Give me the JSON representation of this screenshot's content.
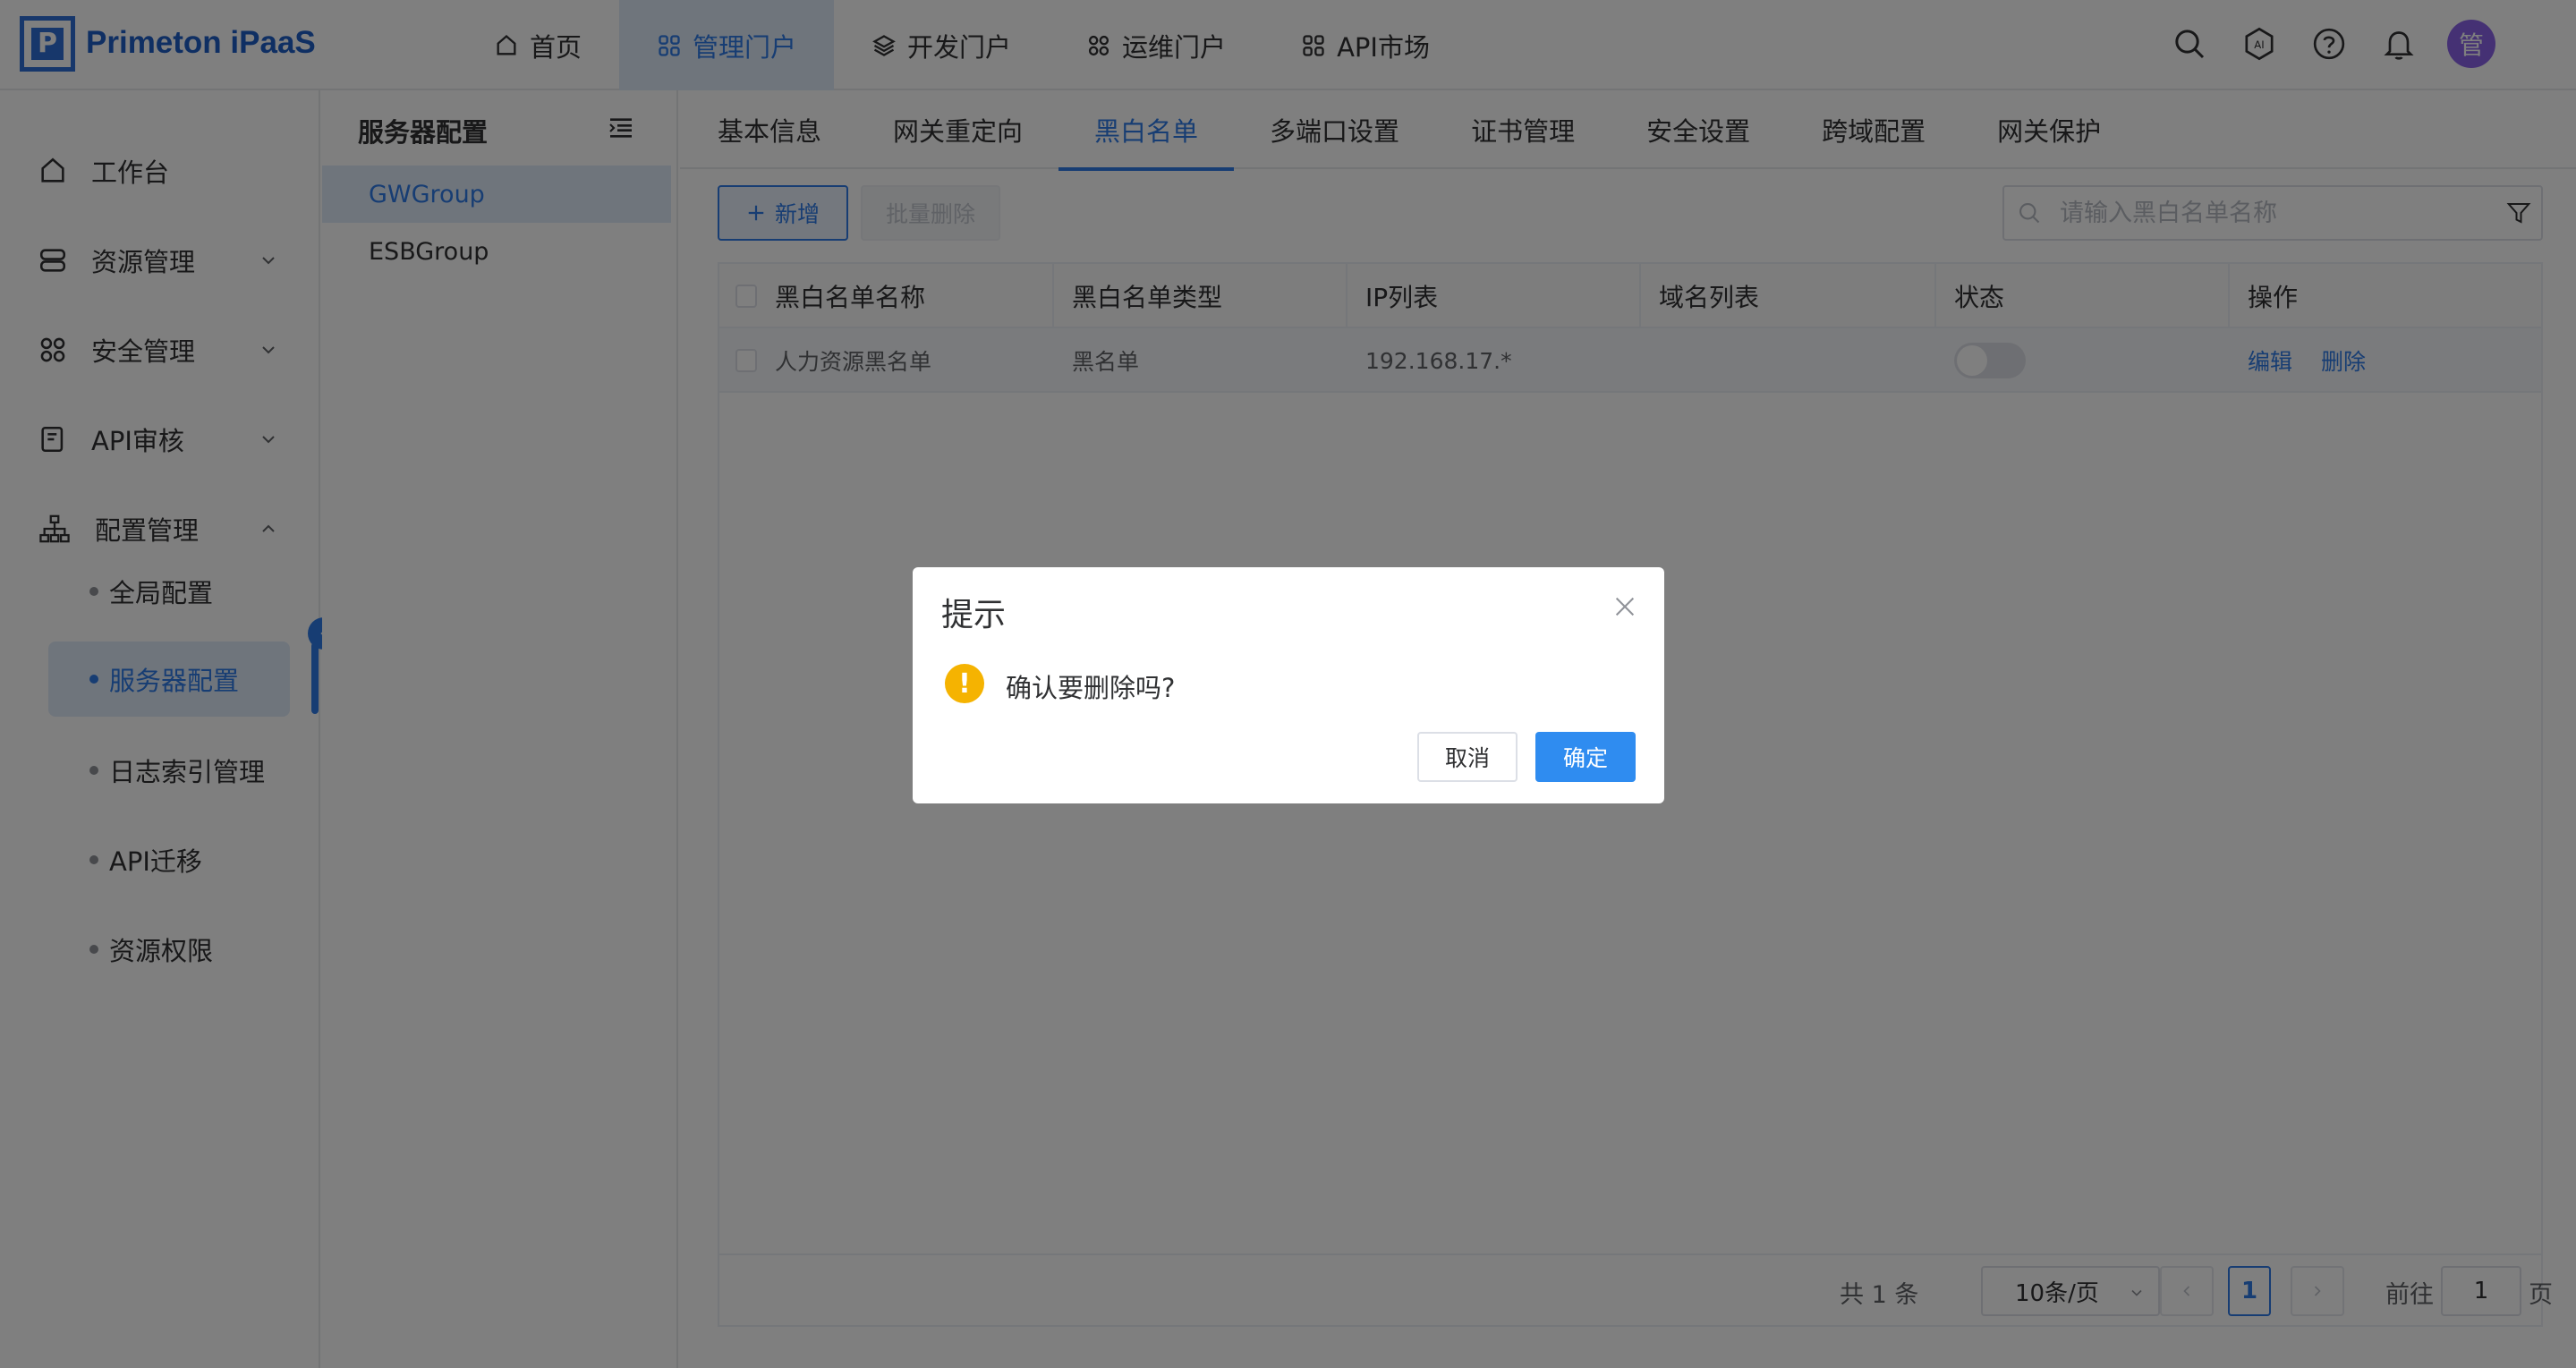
{
  "app": {
    "brand": "Primeton iPaaS",
    "logo_letter": "P"
  },
  "top_nav": [
    {
      "label": "首页",
      "icon": "home-icon",
      "active": false
    },
    {
      "label": "管理门户",
      "icon": "grid-icon",
      "active": true
    },
    {
      "label": "开发门户",
      "icon": "layers-icon",
      "active": false
    },
    {
      "label": "运维门户",
      "icon": "apps-icon",
      "active": false
    },
    {
      "label": "API市场",
      "icon": "grid-icon",
      "active": false
    }
  ],
  "user": {
    "avatar_text": "管"
  },
  "sidebar": {
    "items": [
      {
        "label": "工作台",
        "icon": "home-icon"
      },
      {
        "label": "资源管理",
        "icon": "server-icon"
      },
      {
        "label": "安全管理",
        "icon": "apps-icon"
      },
      {
        "label": "API审核",
        "icon": "document-icon"
      },
      {
        "label": "配置管理",
        "icon": "hierarchy-icon"
      }
    ],
    "sub_items": [
      {
        "label": "全局配置",
        "active": false
      },
      {
        "label": "服务器配置",
        "active": true
      },
      {
        "label": "日志索引管理",
        "active": false
      },
      {
        "label": "API迁移",
        "active": false
      },
      {
        "label": "资源权限",
        "active": false
      }
    ]
  },
  "group_panel": {
    "title": "服务器配置",
    "items": [
      {
        "label": "GWGroup",
        "active": true
      },
      {
        "label": "ESBGroup",
        "active": false
      }
    ]
  },
  "tabs": [
    {
      "label": "基本信息",
      "active": false
    },
    {
      "label": "网关重定向",
      "active": false
    },
    {
      "label": "黑白名单",
      "active": true
    },
    {
      "label": "多端口设置",
      "active": false
    },
    {
      "label": "证书管理",
      "active": false
    },
    {
      "label": "安全设置",
      "active": false
    },
    {
      "label": "跨域配置",
      "active": false
    },
    {
      "label": "网关保护",
      "active": false
    }
  ],
  "toolbar": {
    "add_label": "新增",
    "batch_delete_label": "批量删除",
    "search_placeholder": "请输入黑白名单名称"
  },
  "table": {
    "columns": [
      "黑白名单名称",
      "黑白名单类型",
      "IP列表",
      "域名列表",
      "状态",
      "操作"
    ],
    "rows": [
      {
        "name": "人力资源黑名单",
        "type": "黑名单",
        "ip_list": "192.168.17.*",
        "domain_list": "",
        "status_on": false,
        "edit": "编辑",
        "delete": "删除"
      }
    ]
  },
  "pagination": {
    "total": "共 1 条",
    "page_size": "10条/页",
    "current_page": "1",
    "goto_label": "前往",
    "goto_value": "1",
    "page_suffix": "页"
  },
  "dialog": {
    "title": "提示",
    "message": "确认要删除吗?",
    "cancel_label": "取消",
    "confirm_label": "确定",
    "warn_symbol": "!"
  },
  "colors": {
    "primary": "#2f7be6",
    "warning": "#f5b301",
    "avatar": "#8a63e8"
  }
}
